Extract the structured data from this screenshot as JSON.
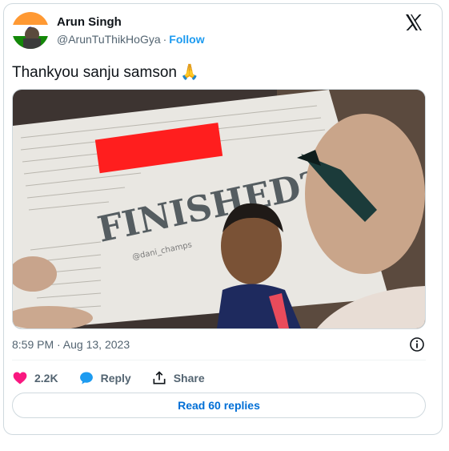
{
  "tweet": {
    "author": {
      "name": "Arun Singh",
      "handle": "@ArunTuThikHoGya",
      "separator": "·",
      "follow_label": "Follow"
    },
    "text": "Thankyou sanju samson",
    "emoji": "🙏",
    "media": {
      "headline": "FINISHED?",
      "watermark": "@dani_champs"
    },
    "timestamp": "8:59 PM · Aug 13, 2023",
    "actions": {
      "likes": "2.2K",
      "reply_label": "Reply",
      "share_label": "Share"
    },
    "read_replies_label": "Read 60 replies"
  },
  "icons": {
    "logo": "x-logo-icon",
    "like": "heart-icon",
    "reply": "speech-bubble-icon",
    "share": "share-icon",
    "info": "info-icon"
  },
  "colors": {
    "accent": "#1d9bf0",
    "like": "#f91880",
    "secondary_text": "#536471",
    "border": "#cfd9de"
  }
}
